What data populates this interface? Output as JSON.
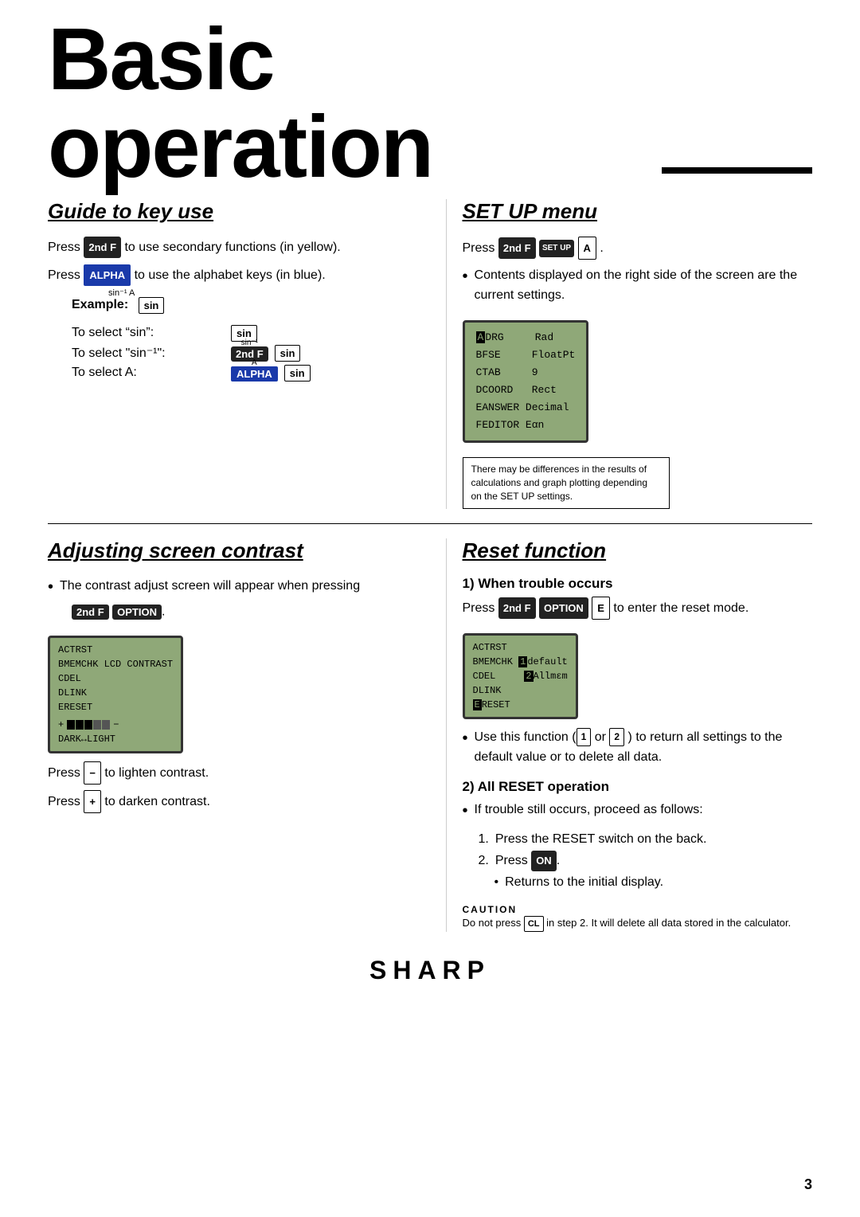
{
  "page": {
    "title": "Basic operation",
    "page_number": "3"
  },
  "guide_section": {
    "title": "Guide to key use",
    "press_2ndf_text": "to use secondary functions (in yellow).",
    "press_alpha_text": "to use the alphabet keys (in blue).",
    "example_label": "Example:",
    "to_select_sin": "To select “sin”:",
    "to_select_sin_inv": "To select “sin⁻¹”:",
    "to_select_A": "To select A:",
    "sin_superscript": "sin⁻¹  A",
    "sin_inv_superscript": "sin⁻¹",
    "A_superscript": "A"
  },
  "setup_section": {
    "title": "SET UP menu",
    "press_text": "Press",
    "period_text": ".",
    "bullet_text": "Contents displayed on the right side of the screen are the current settings.",
    "lcd_rows": [
      {
        "key": "ADRG",
        "val": "Rad"
      },
      {
        "key": "BFSE",
        "val": "FloatPt"
      },
      {
        "key": "CTAB",
        "val": "9"
      },
      {
        "key": "DCOORD",
        "val": "Rect"
      },
      {
        "key": "EANSWER",
        "val": "Decimal"
      },
      {
        "key": "FEDITOR",
        "val": "Eαn"
      }
    ],
    "note_text": "There may be differences in the results of calculations and graph plotting depending on the SET UP settings."
  },
  "contrast_section": {
    "title": "Adjusting screen contrast",
    "bullet_text": "The contrast adjust screen will appear when pressing",
    "key_2ndf": "2nd F",
    "key_option": "OPTION",
    "lcd_rows": [
      "ACTRST",
      "BMEMCHK  LCD CONTRAST",
      "CDEL",
      "DLINK",
      "ERESET",
      "+ ███░░ −",
      "DARK↔LIGHT"
    ],
    "press_minus_text": "to lighten contrast.",
    "press_plus_text": "to darken contrast."
  },
  "reset_section": {
    "title": "Reset function",
    "sub1_title": "1) When trouble occurs",
    "press_reset_text": "to enter the reset mode.",
    "lcd_rows": [
      "ACTRST",
      "BMEMCHK █default",
      "CDEL      █Allmεm",
      "DLINK",
      "ERESET"
    ],
    "bullet_text1": "Use this function (",
    "bullet_1": "1",
    "bullet_or": "or",
    "bullet_2": "2",
    "bullet_text2": ") to return all settings to the default value or to delete all data.",
    "sub2_title": "2) All RESET operation",
    "bullet2_text": "If trouble still occurs, proceed as follows:",
    "step1": "Press the RESET switch on the back.",
    "step2": "Press",
    "step2b": ".",
    "step3_bullet": "Returns to the initial display.",
    "caution_title": "CAUTION",
    "caution_text": "Do not press  CL  in step 2. It will delete all data stored in the calculator."
  },
  "sharp_logo": "SHARP"
}
